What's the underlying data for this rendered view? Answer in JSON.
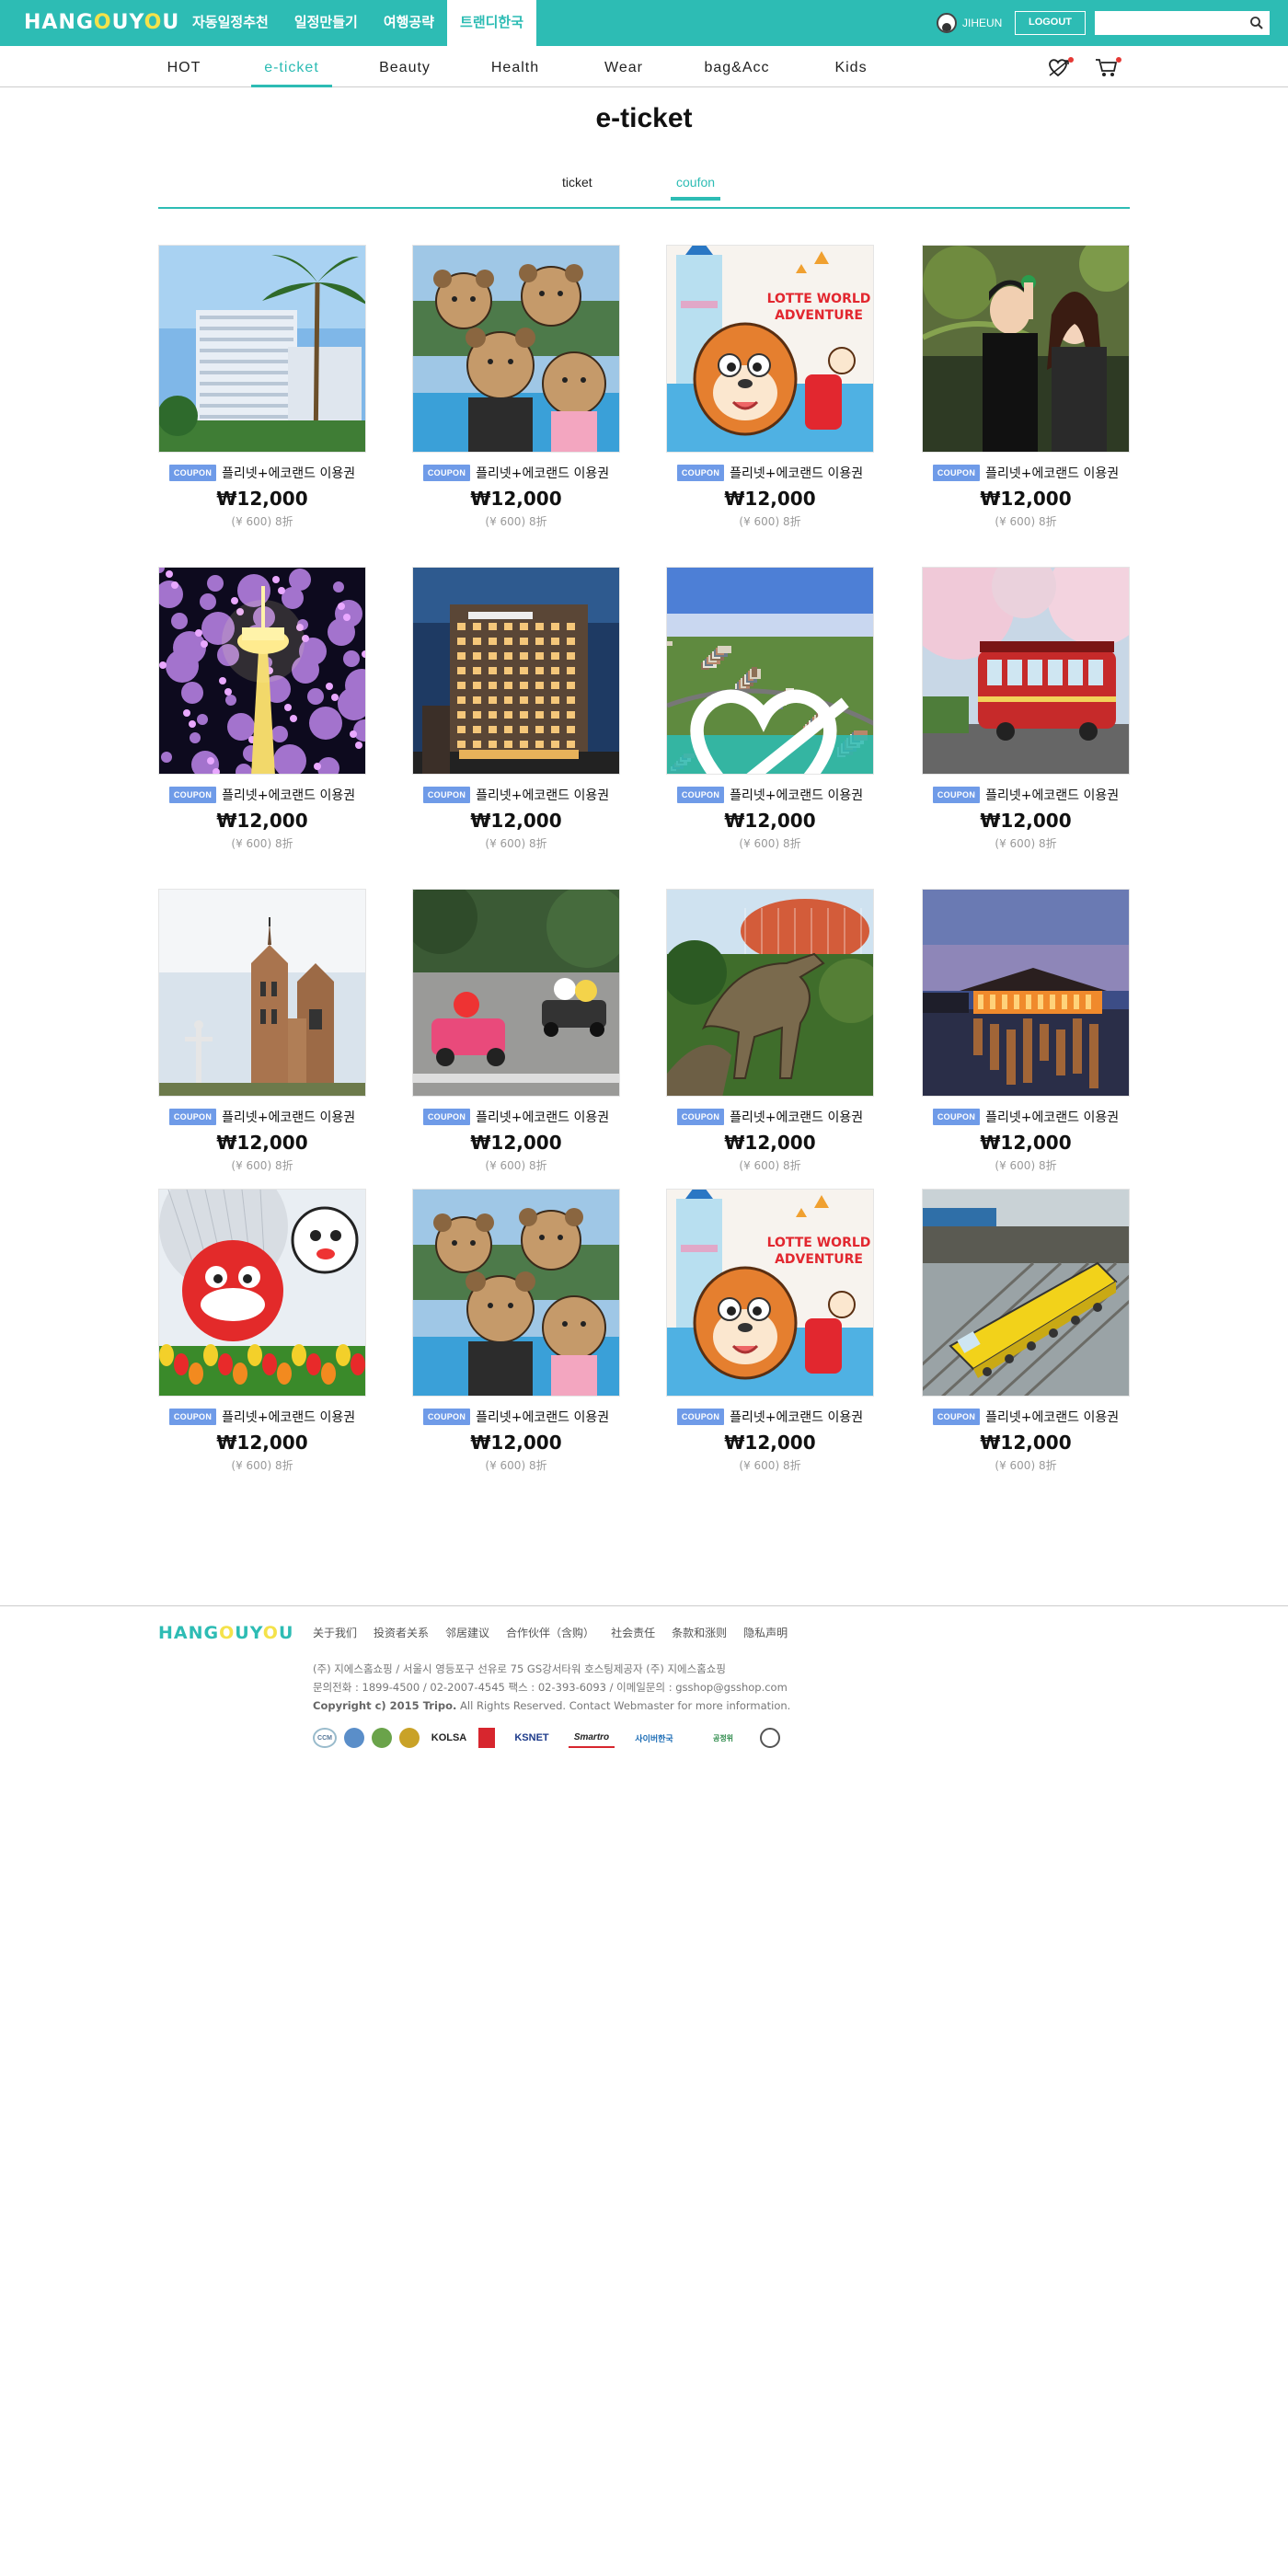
{
  "header": {
    "logo_prefix": "HANG",
    "logo_o1": "O",
    "logo_mid": "UY",
    "logo_o2": "O",
    "logo_suffix": "U",
    "nav": [
      {
        "label": "자동일정추천"
      },
      {
        "label": "일정만들기"
      },
      {
        "label": "여행공략"
      },
      {
        "label": "트랜디한국"
      }
    ],
    "username": "JIHEUN",
    "logout_label": "LOGOUT",
    "search_placeholder": ""
  },
  "categories": [
    {
      "label": "HOT"
    },
    {
      "label": "e-ticket"
    },
    {
      "label": "Beauty"
    },
    {
      "label": "Health"
    },
    {
      "label": "Wear"
    },
    {
      "label": "bag&Acc"
    },
    {
      "label": "Kids"
    }
  ],
  "page": {
    "title": "e-ticket",
    "tabs": [
      {
        "label": "ticket"
      },
      {
        "label": "coufon"
      }
    ]
  },
  "products": [
    {
      "badge": "COUPON",
      "name": "플리넷+에코랜드 이용권",
      "price": "₩12,000",
      "sub": "(¥ 600) 8折",
      "image": "hotel-palms"
    },
    {
      "badge": "COUPON",
      "name": "플리넷+에코랜드 이용권",
      "price": "₩12,000",
      "sub": "(¥ 600) 8折",
      "image": "teddy-bears"
    },
    {
      "badge": "COUPON",
      "name": "플리넷+에코랜드 이용권",
      "price": "₩12,000",
      "sub": "(¥ 600) 8折",
      "image": "lotte-world"
    },
    {
      "badge": "COUPON",
      "name": "플리넷+에코랜드 이용권",
      "price": "₩12,000",
      "sub": "(¥ 600) 8折",
      "image": "couple"
    },
    {
      "badge": "COUPON",
      "name": "플리넷+에코랜드 이용권",
      "price": "₩12,000",
      "sub": "(¥ 600) 8折",
      "image": "tower-night"
    },
    {
      "badge": "COUPON",
      "name": "플리넷+에코랜드 이용권",
      "price": "₩12,000",
      "sub": "(¥ 600) 8折",
      "image": "hotel-night"
    },
    {
      "badge": "COUPON",
      "name": "플리넷+에코랜드 이용권",
      "price": "₩12,000",
      "sub": "(¥ 600) 8折",
      "image": "village-aerial"
    },
    {
      "badge": "COUPON",
      "name": "플리넷+에코랜드 이용권",
      "price": "₩12,000",
      "sub": "(¥ 600) 8折",
      "image": "red-trolley"
    },
    {
      "badge": "COUPON",
      "name": "플리넷+에코랜드 이용권",
      "price": "₩12,000",
      "sub": "(¥ 600) 8折",
      "image": "cathedral"
    },
    {
      "badge": "COUPON",
      "name": "플리넷+에코랜드 이용권",
      "price": "₩12,000",
      "sub": "(¥ 600) 8折",
      "image": "go-kart"
    },
    {
      "badge": "COUPON",
      "name": "플리넷+에코랜드 이용권",
      "price": "₩12,000",
      "sub": "(¥ 600) 8折",
      "image": "dinosaur"
    },
    {
      "badge": "COUPON",
      "name": "플리넷+에코랜드 이용권",
      "price": "₩12,000",
      "sub": "(¥ 600) 8折",
      "image": "pavilion-lake"
    },
    {
      "badge": "COUPON",
      "name": "플리넷+에코랜드 이용권",
      "price": "₩12,000",
      "sub": "(¥ 600) 8折",
      "image": "mascot-tulips"
    },
    {
      "badge": "COUPON",
      "name": "플리넷+에코랜드 이용권",
      "price": "₩12,000",
      "sub": "(¥ 600) 8折",
      "image": "teddy-bears"
    },
    {
      "badge": "COUPON",
      "name": "플리넷+에코랜드 이용권",
      "price": "₩12,000",
      "sub": "(¥ 600) 8折",
      "image": "lotte-world"
    },
    {
      "badge": "COUPON",
      "name": "플리넷+에코랜드 이용권",
      "price": "₩12,000",
      "sub": "(¥ 600) 8折",
      "image": "yellow-train"
    }
  ],
  "lotte_sign": {
    "line1": "LOTTE WORLD",
    "line2": "ADVENTURE"
  },
  "footer": {
    "links": [
      {
        "label": "关于我们"
      },
      {
        "label": "投资者关系"
      },
      {
        "label": "邻居建议"
      },
      {
        "label": "合作伙伴（含购）"
      },
      {
        "label": "社会责任"
      },
      {
        "label": "条款和涨则"
      },
      {
        "label": "隐私声明"
      }
    ],
    "info_line1": "(주) 지에스홈쇼핑  / 서울시 영등포구 선유로 75 GS강서타워 호스팅제공자 (주) 지에스홈쇼핑",
    "info_line2": "문의전화 : 1899-4500 / 02-2007-4545 팩스 : 02-393-6093 / 이메일문의 : gsshop@gsshop.com",
    "copyright_bold": "Copyright c) 2015 Tripo.",
    "copyright_rest": " All Rights Reserved. Contact Webmaster for more information.",
    "certs": [
      {
        "label": "CCM"
      },
      {
        "label": ""
      },
      {
        "label": ""
      },
      {
        "label": ""
      },
      {
        "label": "KOLSA"
      },
      {
        "label": ""
      },
      {
        "label": "KSNET"
      },
      {
        "label": "Smartro"
      },
      {
        "label": "사이버한국"
      },
      {
        "label": "공정위"
      },
      {
        "label": ""
      }
    ]
  },
  "colors": {
    "accent": "#2dbcb4",
    "coupon": "#6f9be8",
    "logo_o": "#f4e24a"
  }
}
